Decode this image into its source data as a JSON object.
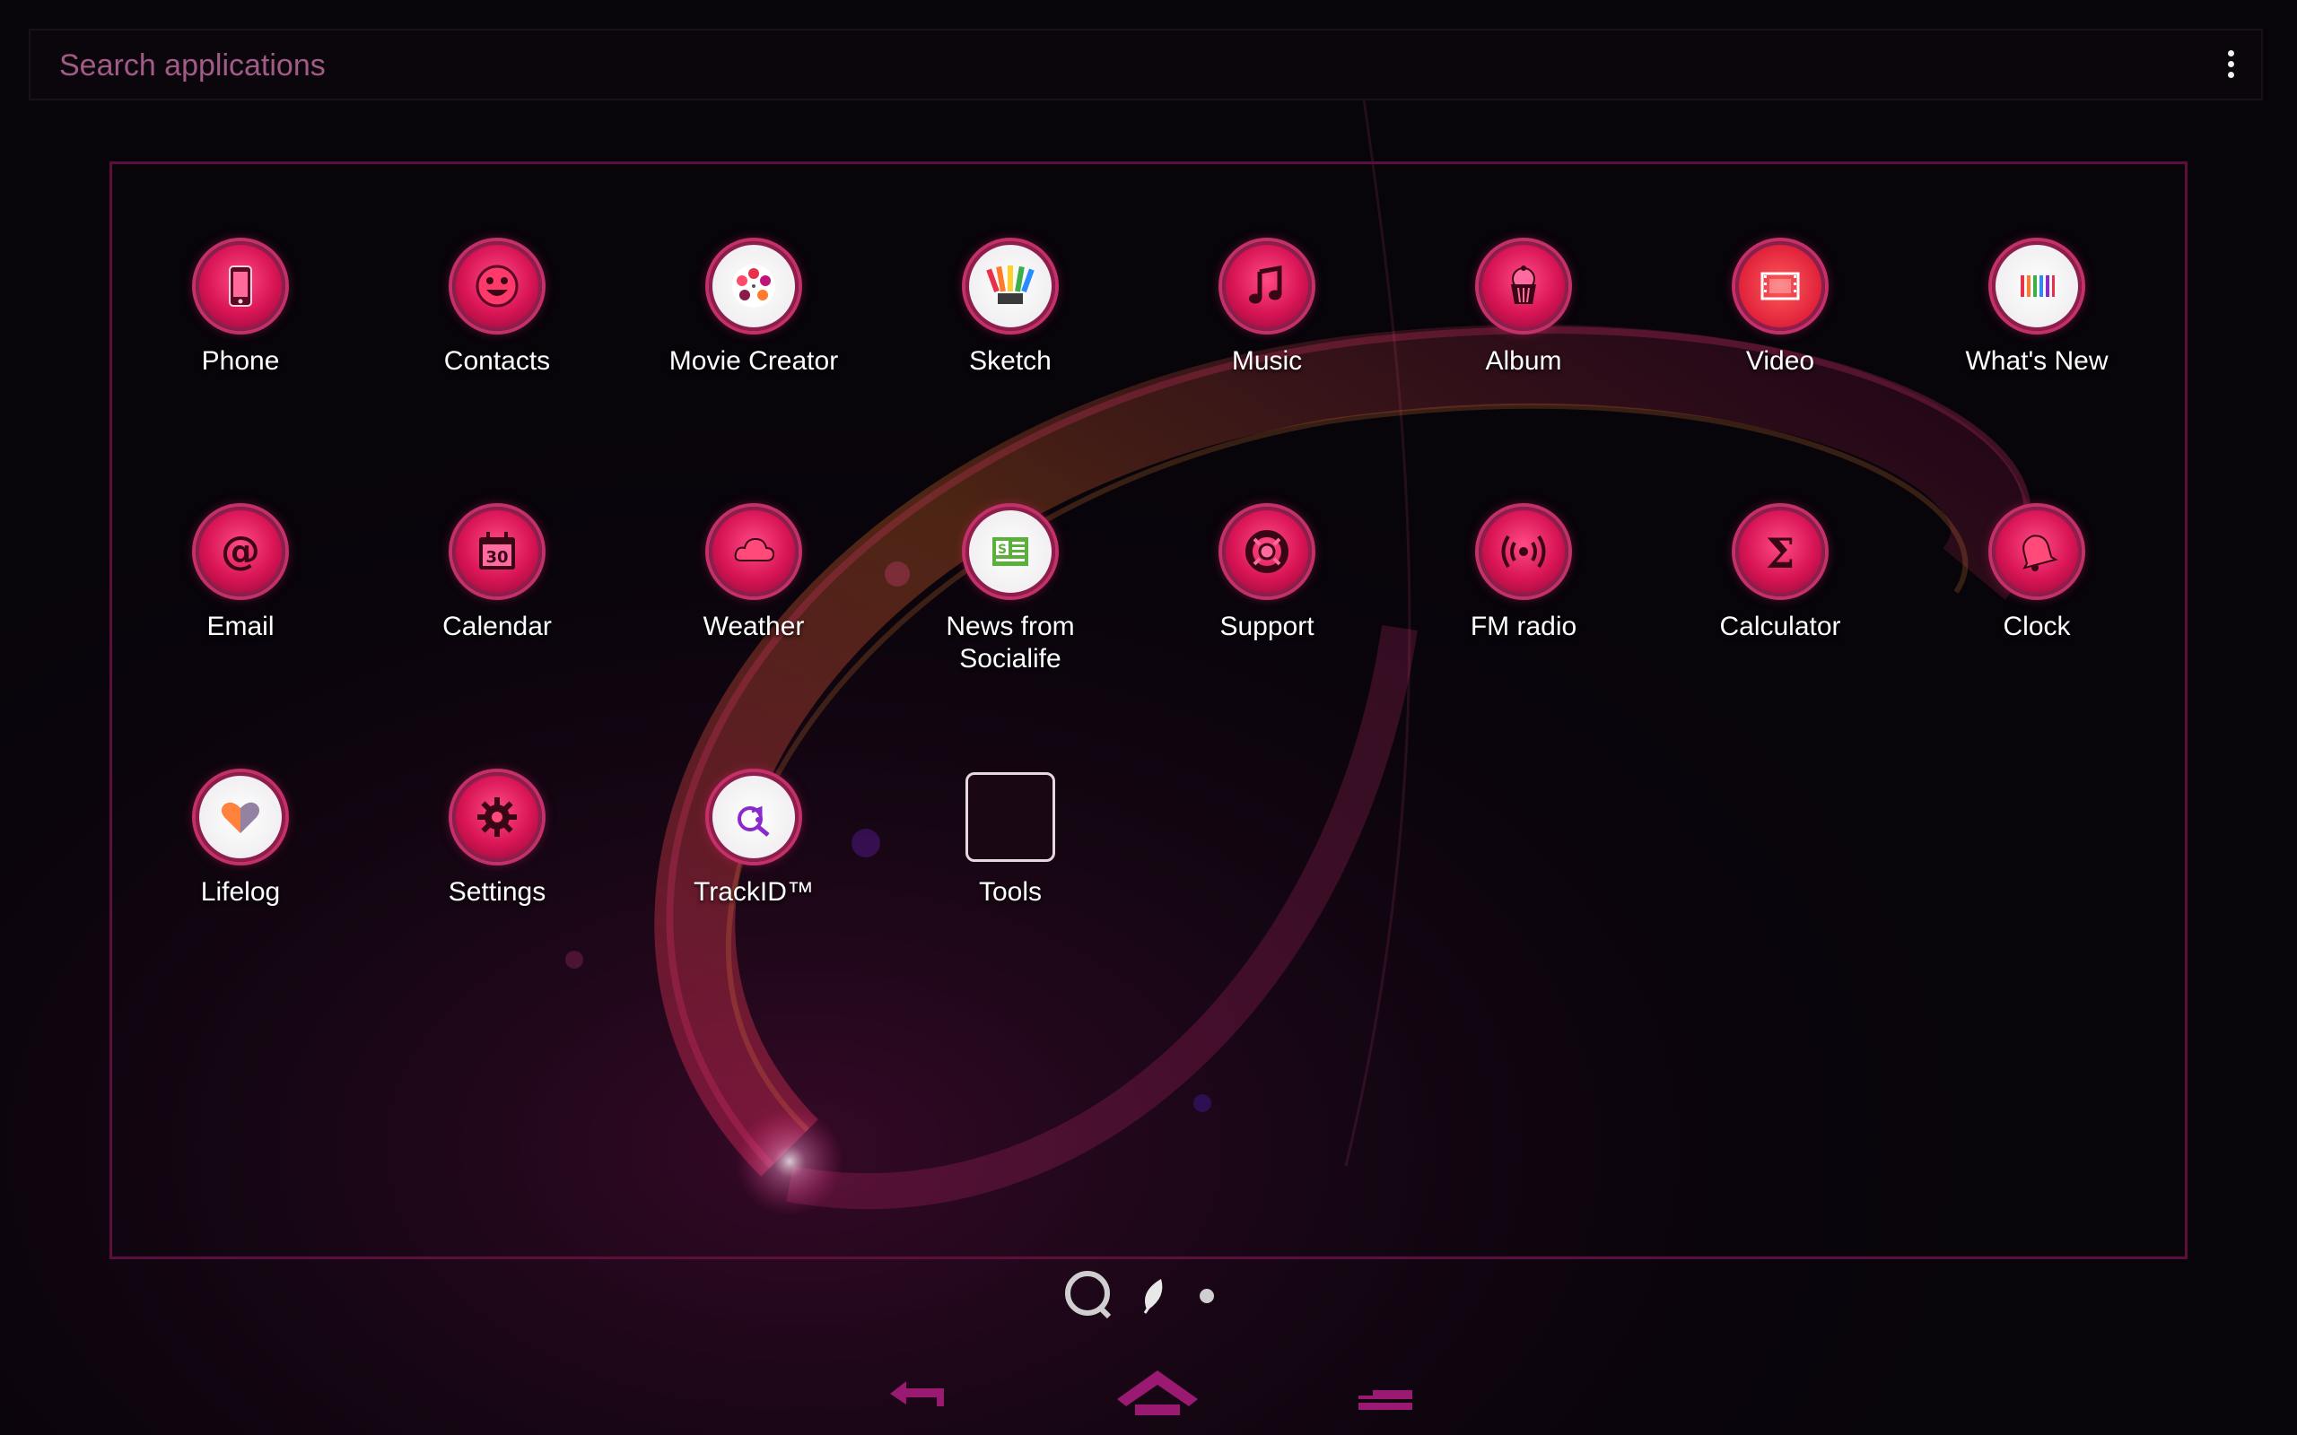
{
  "search": {
    "placeholder": "Search applications"
  },
  "apps": [
    {
      "label": "Phone",
      "icon": "phone-icon"
    },
    {
      "label": "Contacts",
      "icon": "smiley-icon"
    },
    {
      "label": "Movie Creator",
      "icon": "film-reel-icon"
    },
    {
      "label": "Sketch",
      "icon": "color-fan-icon"
    },
    {
      "label": "Music",
      "icon": "music-note-icon"
    },
    {
      "label": "Album",
      "icon": "cupcake-icon"
    },
    {
      "label": "Video",
      "icon": "film-strip-icon"
    },
    {
      "label": "What's New",
      "icon": "color-bars-icon"
    },
    {
      "label": "Email",
      "icon": "at-sign-icon"
    },
    {
      "label": "Calendar",
      "icon": "calendar-icon",
      "badge": "30"
    },
    {
      "label": "Weather",
      "icon": "cloud-icon"
    },
    {
      "label": "News from\nSocialife",
      "icon": "newspaper-icon",
      "badge": "S"
    },
    {
      "label": "Support",
      "icon": "lifebuoy-icon"
    },
    {
      "label": "FM radio",
      "icon": "radio-waves-icon"
    },
    {
      "label": "Calculator",
      "icon": "sigma-icon",
      "badge": "Σ"
    },
    {
      "label": "Clock",
      "icon": "alarm-bell-icon"
    },
    {
      "label": "Lifelog",
      "icon": "heart-icon"
    },
    {
      "label": "Settings",
      "icon": "gear-icon"
    },
    {
      "label": "TrackID™",
      "icon": "trackid-icon"
    },
    {
      "label": "Tools",
      "icon": "folder-icon"
    }
  ],
  "page_indicator": {
    "icons": [
      "search-page-icon",
      "leaf-page-icon",
      "dot-page-icon"
    ]
  },
  "nav": {
    "buttons": [
      "back-icon",
      "home-icon",
      "recent-apps-icon"
    ]
  },
  "colors": {
    "accent": "#d81455",
    "panel_border": "#5c0f3c",
    "nav": "#8a1466"
  }
}
